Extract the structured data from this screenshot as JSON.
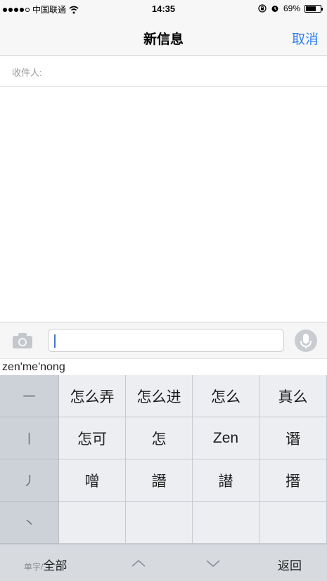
{
  "status_bar": {
    "carrier": "中国联通",
    "time": "14:35",
    "battery_text": "69%",
    "battery_level": 0.69,
    "signal_filled": 4,
    "signal_total": 5
  },
  "nav": {
    "title": "新信息",
    "cancel_label": "取消",
    "accent_color": "#2f7ff0"
  },
  "recipient": {
    "label": "收件人:",
    "value": ""
  },
  "compose": {
    "value": "",
    "icons": [
      "camera-icon",
      "microphone-icon"
    ]
  },
  "ime": {
    "pinyin": "zen'me'nong",
    "strokes": [
      "一",
      "丨",
      "丿",
      "丶"
    ],
    "candidates": [
      [
        "怎么弄",
        "怎么进",
        "怎么",
        "真么"
      ],
      [
        "怎可",
        "怎",
        "Zen",
        "谮"
      ],
      [
        "噌",
        "譖",
        "譛",
        "撍"
      ],
      [
        "",
        "",
        "",
        ""
      ]
    ],
    "mode_small": "单字/",
    "mode_large": "全部",
    "up_icon": "chevron-up-icon",
    "down_icon": "chevron-down-icon",
    "back_label": "返回"
  }
}
